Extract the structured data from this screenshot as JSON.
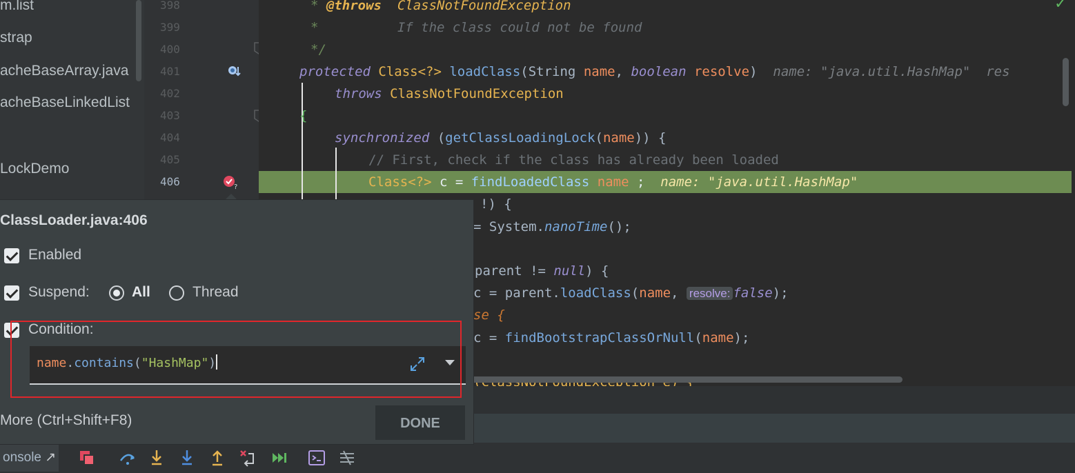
{
  "sidebar": {
    "items": [
      "m.list",
      "strap",
      "acheBaseArray.java",
      "acheBaseLinkedList",
      "LockDemo"
    ]
  },
  "gutter": {
    "lines": [
      "398",
      "399",
      "400",
      "401",
      "402",
      "403",
      "404",
      "405",
      "406"
    ]
  },
  "code": {
    "l398_tag": "@throws",
    "l398_text": "  ClassNotFoundException",
    "l399_text": "          If the class could not be found",
    "l400_text": "*/",
    "l398_star": "*",
    "l399_star": "*",
    "l401_kw": "protected",
    "l401_type": " Class<?>",
    "l401_fn": " loadClass",
    "l401_p1": "(String ",
    "l401_name": "name",
    "l401_comma": ", ",
    "l401_bool": "boolean",
    "l401_resolve": " resolve",
    "l401_close": ")",
    "l401_hint": "  name: \"java.util.HashMap\"  res",
    "l402_kw": "throws",
    "l402_text": " ClassNotFoundException",
    "l403_brace": "{",
    "l404_kw": "synchronized",
    "l404_p": " (",
    "l404_fn": "getClassLoadingLock",
    "l404_a": "(",
    "l404_name": "name",
    "l404_b": ")) {",
    "l405_comment": "// First, check if the class has already been loaded",
    "l406_type": "Class<?>",
    "l406_c": " c = ",
    "l406_fn": "findLoadedClass",
    "l406_name": " name ",
    "l406_semi": ";",
    "l406_hint": "  name: \"java.util.HashMap\"",
    "l407": "!) {",
    "l408_pre": "= System.",
    "l408_fn": "nanoTime",
    "l408_post": "();",
    "l410_pre": "parent != ",
    "l410_null": "null",
    "l410_post": ") {",
    "l411_pre": "c = parent.",
    "l411_fn": "loadClass",
    "l411_a": "(",
    "l411_name": "name",
    "l411_comma": ", ",
    "l411_hint": "resolve:",
    "l411_false": "false",
    "l411_close": ");",
    "l412": "se {",
    "l413_pre": "c = ",
    "l413_fn": "findBootstrapClassOrNull",
    "l413_a": "(",
    "l413_name": "name",
    "l413_close": ");",
    "l415": "(ClassNotFoundException e) {"
  },
  "popup": {
    "title": "ClassLoader.java:406",
    "enabled_label": "Enabled",
    "suspend_label": "Suspend:",
    "all_label": "All",
    "thread_label": "Thread",
    "condition_label": "Condition:",
    "condition_value_obj": "name",
    "condition_value_dot": ".",
    "condition_value_fn": "contains",
    "condition_value_open": "(",
    "condition_value_str": "\"HashMap\"",
    "condition_value_close": ")",
    "more_link": "More (Ctrl+Shift+F8)",
    "done_label": "DONE"
  },
  "toolbar": {
    "console_label": "onsole",
    "console_icon": "↗"
  },
  "colors": {
    "highlight": "#6d8c52",
    "red_box": "#e0262b",
    "accent_blue": "#5aa2e0"
  }
}
